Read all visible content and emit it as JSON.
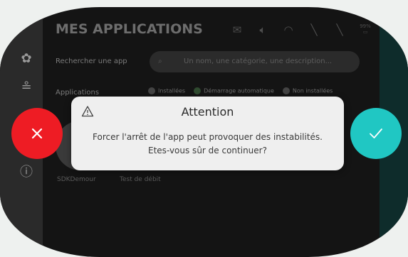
{
  "header": {
    "title": "MES APPLICATIONS",
    "status_icons": [
      "mail-icon",
      "volume-icon",
      "wifi-icon",
      "signal-off-icon",
      "signal-off-icon",
      "battery-icon"
    ],
    "battery_label": "99%"
  },
  "search": {
    "label": "Rechercher une app",
    "placeholder": "Un nom, une catégorie, une description..."
  },
  "apps": {
    "label": "Applications",
    "legend": [
      "Installées",
      "Démarrage automatique",
      "Non installées"
    ],
    "items": [
      "SDKDemour",
      "Test de débit"
    ]
  },
  "sidebar": {
    "items": [
      "apps-icon",
      "storage-icon",
      "info-icon"
    ]
  },
  "dialog": {
    "title": "Attention",
    "message_line1": "Forcer l'arrêt de l'app peut provoquer des instabilités.",
    "message_line2": "Etes-vous sûr de continuer?"
  },
  "colors": {
    "cancel": "#ee1c24",
    "confirm": "#20c7c3",
    "dialog_bg": "#efefef"
  }
}
